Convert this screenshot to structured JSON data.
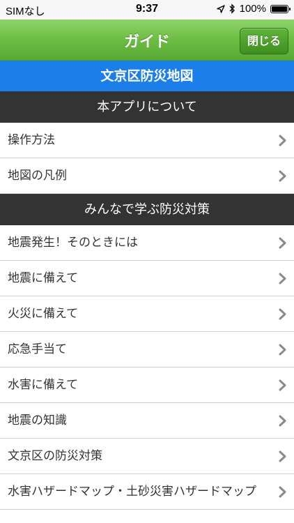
{
  "status_bar": {
    "carrier": "SIMなし",
    "time": "9:37",
    "battery": "100%",
    "battery_level": 1.0
  },
  "nav": {
    "title": "ガイド",
    "close_label": "閉じる"
  },
  "app_header": "文京区防災地図",
  "sections": [
    {
      "title": "本アプリについて",
      "items": [
        "操作方法",
        "地図の凡例"
      ]
    },
    {
      "title": "みんなで学ぶ防災対策",
      "items": [
        "地震発生！そのときには",
        "地震に備えて",
        "火災に備えて",
        "応急手当て",
        "水害に備えて",
        "地震の知識",
        "文京区の防災対策",
        "水害ハザードマップ・土砂災害ハザードマップ"
      ]
    }
  ],
  "icons": {
    "row_indicator": "chevron-right-icon",
    "location": "location-arrow-icon",
    "bluetooth": "bluetooth-icon",
    "battery": "battery-icon"
  },
  "colors": {
    "nav_green": "#6cbd44",
    "header_blue": "#1c7ee8",
    "section_dark": "#333333"
  }
}
